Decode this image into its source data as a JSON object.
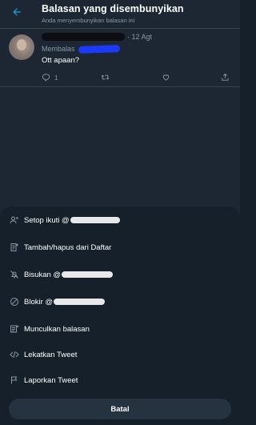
{
  "header": {
    "title": "Balasan yang disembunyikan",
    "subtitle": "Anda menyembunyikan balasan ini",
    "back_icon": "arrow-left-icon"
  },
  "tweet": {
    "date": "· 12 Agt",
    "replying_label": "Membalas",
    "text": "Ott apaan?",
    "reply_count": "1",
    "icons": [
      "reply-icon",
      "retweet-icon",
      "like-icon",
      "share-icon"
    ]
  },
  "menu": {
    "items": [
      {
        "label": "Setop ikuti @",
        "icon": "unfollow-icon",
        "redacted": true
      },
      {
        "label": "Tambah/hapus dari Daftar",
        "icon": "list-add-icon",
        "redacted": false
      },
      {
        "label": "Bisukan @",
        "icon": "mute-icon",
        "redacted": true
      },
      {
        "label": "Blokir @",
        "icon": "block-icon",
        "redacted": true
      },
      {
        "label": "Munculkan balasan",
        "icon": "unhide-reply-icon",
        "redacted": false
      },
      {
        "label": "Lekatkan Tweet",
        "icon": "embed-code-icon",
        "redacted": false
      },
      {
        "label": "Laporkan Tweet",
        "icon": "report-flag-icon",
        "redacted": false
      }
    ],
    "cancel_label": "Batal"
  },
  "colors": {
    "background": "#1c2733",
    "sheet": "#15202b",
    "accent": "#1da1f2",
    "secondary_text": "#8899a6",
    "divider": "#38444d",
    "button": "#253341"
  }
}
